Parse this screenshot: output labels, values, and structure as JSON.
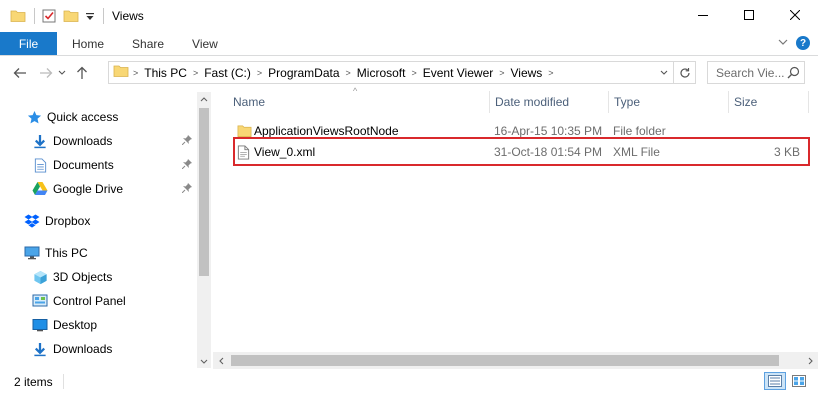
{
  "window": {
    "title": "Views",
    "minimize_glyph": "—",
    "maximize_glyph": "☐",
    "close_glyph": "✕"
  },
  "ribbon": {
    "file_label": "File",
    "tabs": [
      "Home",
      "Share",
      "View"
    ],
    "expand_glyph": "⌄",
    "help_glyph": "?"
  },
  "nav": {
    "back_glyph": "←",
    "forward_glyph": "→",
    "recent_glyph": "⌄",
    "up_glyph": "↑"
  },
  "address": {
    "crumbs": [
      "This PC",
      "Fast (C:)",
      "ProgramData",
      "Microsoft",
      "Event Viewer",
      "Views"
    ],
    "dropdown_glyph": "⌄",
    "refresh_glyph": "↻"
  },
  "search": {
    "placeholder": "Search Vie..."
  },
  "navpane": {
    "items": [
      {
        "label": "Quick access",
        "icon": "star-icon",
        "pinned": false
      },
      {
        "label": "Downloads",
        "icon": "download-arrow-icon",
        "pinned": true
      },
      {
        "label": "Documents",
        "icon": "document-icon",
        "pinned": true
      },
      {
        "label": "Google Drive",
        "icon": "google-drive-icon",
        "pinned": true
      },
      {
        "label": "Dropbox",
        "icon": "dropbox-icon",
        "pinned": false
      },
      {
        "label": "This PC",
        "icon": "computer-icon",
        "pinned": false
      },
      {
        "label": "3D Objects",
        "icon": "cube-icon",
        "pinned": false
      },
      {
        "label": "Control Panel",
        "icon": "control-panel-icon",
        "pinned": false
      },
      {
        "label": "Desktop",
        "icon": "desktop-icon",
        "pinned": false
      },
      {
        "label": "Downloads",
        "icon": "download-arrow-icon",
        "pinned": false
      }
    ],
    "pin_glyph": "📌"
  },
  "columns": [
    "Name",
    "Date modified",
    "Type",
    "Size"
  ],
  "sort_caret": "^",
  "files": [
    {
      "name": "ApplicationViewsRootNode",
      "date": "16-Apr-15 10:35 PM",
      "type": "File folder",
      "size": "",
      "icon": "folder-icon"
    },
    {
      "name": "View_0.xml",
      "date": "31-Oct-18 01:54 PM",
      "type": "XML File",
      "size": "3 KB",
      "icon": "xml-file-icon"
    }
  ],
  "status": {
    "count": "2 items"
  },
  "colors": {
    "accent": "#1979ca",
    "highlight_border": "#d9292c",
    "folder": "#f8d775",
    "column_header": "#4c607a",
    "meta_text": "#6d6d6d"
  }
}
